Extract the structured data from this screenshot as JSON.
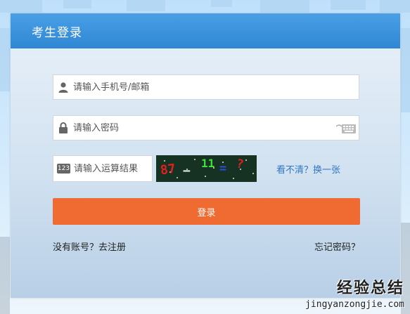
{
  "panel": {
    "title": "考生登录"
  },
  "form": {
    "phone_placeholder": "请输入手机号/邮箱",
    "password_placeholder": "请输入密码",
    "calc_placeholder": "请输入运算结果",
    "calc_badge": "123",
    "captcha": {
      "num1": "87",
      "op": "−",
      "num2": "11",
      "eq": "=",
      "q": "?"
    },
    "refresh_label": "看不清？换一张",
    "login_label": "登录",
    "register_label": "没有账号？去注册",
    "forgot_label": "忘记密码？"
  },
  "watermark": {
    "main": "经验总结",
    "sub": "jingyanzongjie.com"
  },
  "colors": {
    "header": "#2f86d3",
    "login_button": "#f06b31",
    "link": "#2f77c6"
  },
  "icons": {
    "phone_field": "user-icon",
    "password_field": "lock-icon",
    "keyboard": "keyboard-icon"
  }
}
